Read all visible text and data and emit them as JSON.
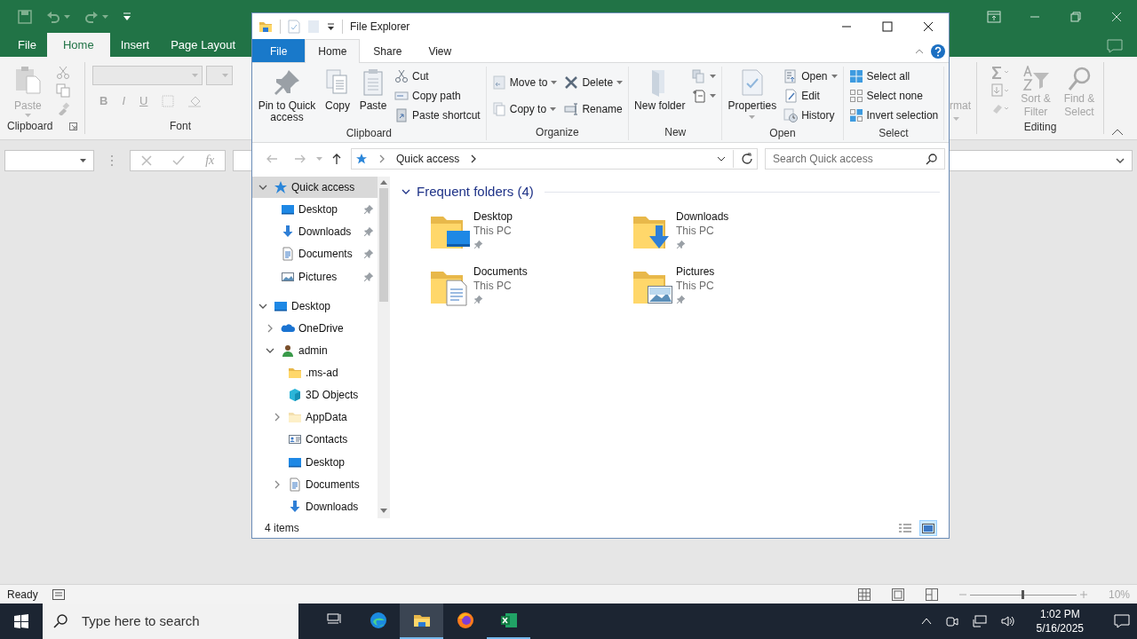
{
  "excel": {
    "tabs": [
      {
        "label": "File",
        "selected": false
      },
      {
        "label": "Home",
        "selected": true
      },
      {
        "label": "Insert",
        "selected": false
      },
      {
        "label": "Page Layout",
        "selected": false
      }
    ],
    "clipboard": {
      "paste": "Paste",
      "label": "Clipboard"
    },
    "font": {
      "bold": "B",
      "italic": "I",
      "underline": "U",
      "label": "Font"
    },
    "cells_fragment": "rmat",
    "editing": {
      "sort": "Sort & Filter",
      "find": "Find & Select",
      "label": "Editing"
    },
    "formula": {
      "function_label": "fx"
    },
    "status": "Ready",
    "zoom": {
      "label": "10%",
      "level": 0.5
    }
  },
  "explorer": {
    "title": "File Explorer",
    "tabs": [
      {
        "label": "File",
        "kind": "file",
        "selected": false
      },
      {
        "label": "Home",
        "kind": "tab",
        "selected": true
      },
      {
        "label": "Share",
        "kind": "tab",
        "selected": false
      },
      {
        "label": "View",
        "kind": "tab",
        "selected": false
      }
    ],
    "ribbon": [
      {
        "label": "Clipboard",
        "large": [
          {
            "label": "Pin to Quick access",
            "kind": "pin"
          },
          {
            "label": "Copy",
            "kind": "copy"
          },
          {
            "label": "Paste",
            "kind": "paste"
          }
        ],
        "small": [
          {
            "label": "Cut",
            "kind": "cut",
            "dropdown": false
          },
          {
            "label": "Copy path",
            "kind": "path",
            "dropdown": false
          },
          {
            "label": "Paste shortcut",
            "kind": "shortcut",
            "dropdown": false
          }
        ]
      },
      {
        "label": "Organize",
        "small": [
          {
            "label": "Move to",
            "kind": "move",
            "dropdown": true
          },
          {
            "label": "Copy to",
            "kind": "copyto",
            "dropdown": true
          },
          {
            "label": "Delete",
            "kind": "delete",
            "dropdown": true
          },
          {
            "label": "Rename",
            "kind": "rename",
            "dropdown": false
          }
        ]
      },
      {
        "label": "New",
        "large": [
          {
            "label": "New folder",
            "kind": "newfolder"
          }
        ],
        "small": [
          {
            "kind": "newitem",
            "dropdown": true
          },
          {
            "kind": "easyaccess",
            "dropdown": true
          }
        ]
      },
      {
        "label": "Open",
        "large": [
          {
            "label": "Properties",
            "kind": "properties",
            "dropdown": true
          }
        ],
        "small": [
          {
            "label": "Open",
            "kind": "open",
            "dropdown": true
          },
          {
            "label": "Edit",
            "kind": "edit",
            "dropdown": false
          },
          {
            "label": "History",
            "kind": "history",
            "dropdown": false
          }
        ]
      },
      {
        "label": "Select",
        "small": [
          {
            "label": "Select all",
            "kind": "selectall",
            "dropdown": false
          },
          {
            "label": "Select none",
            "kind": "selectnone",
            "dropdown": false
          },
          {
            "label": "Invert selection",
            "kind": "invert",
            "dropdown": false
          }
        ]
      }
    ],
    "address": {
      "path": [
        "Quick access"
      ],
      "search_placeholder": "Search Quick access"
    },
    "tree": [
      {
        "label": "Quick access",
        "kind": "quick",
        "expanded": true,
        "selected": true,
        "children": [
          {
            "label": "Desktop",
            "kind": "desktop",
            "pinned": true,
            "selected": false
          },
          {
            "label": "Downloads",
            "kind": "downloads",
            "pinned": true,
            "selected": false
          },
          {
            "label": "Documents",
            "kind": "documents",
            "pinned": true,
            "selected": false
          },
          {
            "label": "Pictures",
            "kind": "pictures",
            "pinned": true,
            "selected": false
          }
        ]
      },
      {
        "label": "Desktop",
        "kind": "desktop",
        "expanded": true,
        "selected": false,
        "children": [
          {
            "label": "OneDrive",
            "kind": "onedrive",
            "expanded": false,
            "selected": false
          },
          {
            "label": "admin",
            "kind": "user",
            "expanded": true,
            "selected": false,
            "children": [
              {
                "label": ".ms-ad",
                "kind": "folder",
                "selected": false
              },
              {
                "label": "3D Objects",
                "kind": "objects",
                "selected": false
              },
              {
                "label": "AppData",
                "kind": "hidden",
                "expanded": false,
                "selected": false
              },
              {
                "label": "Contacts",
                "kind": "contacts",
                "selected": false
              },
              {
                "label": "Desktop",
                "kind": "desktop",
                "selected": false
              },
              {
                "label": "Documents",
                "kind": "documents",
                "expanded": false,
                "selected": false
              },
              {
                "label": "Downloads",
                "kind": "downloads",
                "selected": false
              }
            ]
          }
        ]
      }
    ],
    "content": {
      "group": "Frequent folders (4)",
      "expanded": true,
      "tiles": [
        {
          "name": "Desktop",
          "location": "This PC",
          "kind": "desktop",
          "pinned": true
        },
        {
          "name": "Downloads",
          "location": "This PC",
          "kind": "downloads",
          "pinned": true
        },
        {
          "name": "Documents",
          "location": "This PC",
          "kind": "documents",
          "pinned": true
        },
        {
          "name": "Pictures",
          "location": "This PC",
          "kind": "pictures",
          "pinned": true
        }
      ]
    },
    "status": "4 items",
    "views": [
      {
        "kind": "details",
        "selected": false
      },
      {
        "kind": "tiles",
        "selected": true
      }
    ]
  },
  "taskbar": {
    "search_placeholder": "Type here to search",
    "apps": [
      {
        "kind": "taskview",
        "running": false,
        "active": false
      },
      {
        "kind": "edge",
        "running": false,
        "active": false
      },
      {
        "kind": "explorer",
        "running": true,
        "active": true
      },
      {
        "kind": "firefox",
        "running": false,
        "active": false
      },
      {
        "kind": "excel",
        "running": true,
        "active": false
      }
    ],
    "time": "1:02 PM",
    "date": "5/16/2025"
  }
}
